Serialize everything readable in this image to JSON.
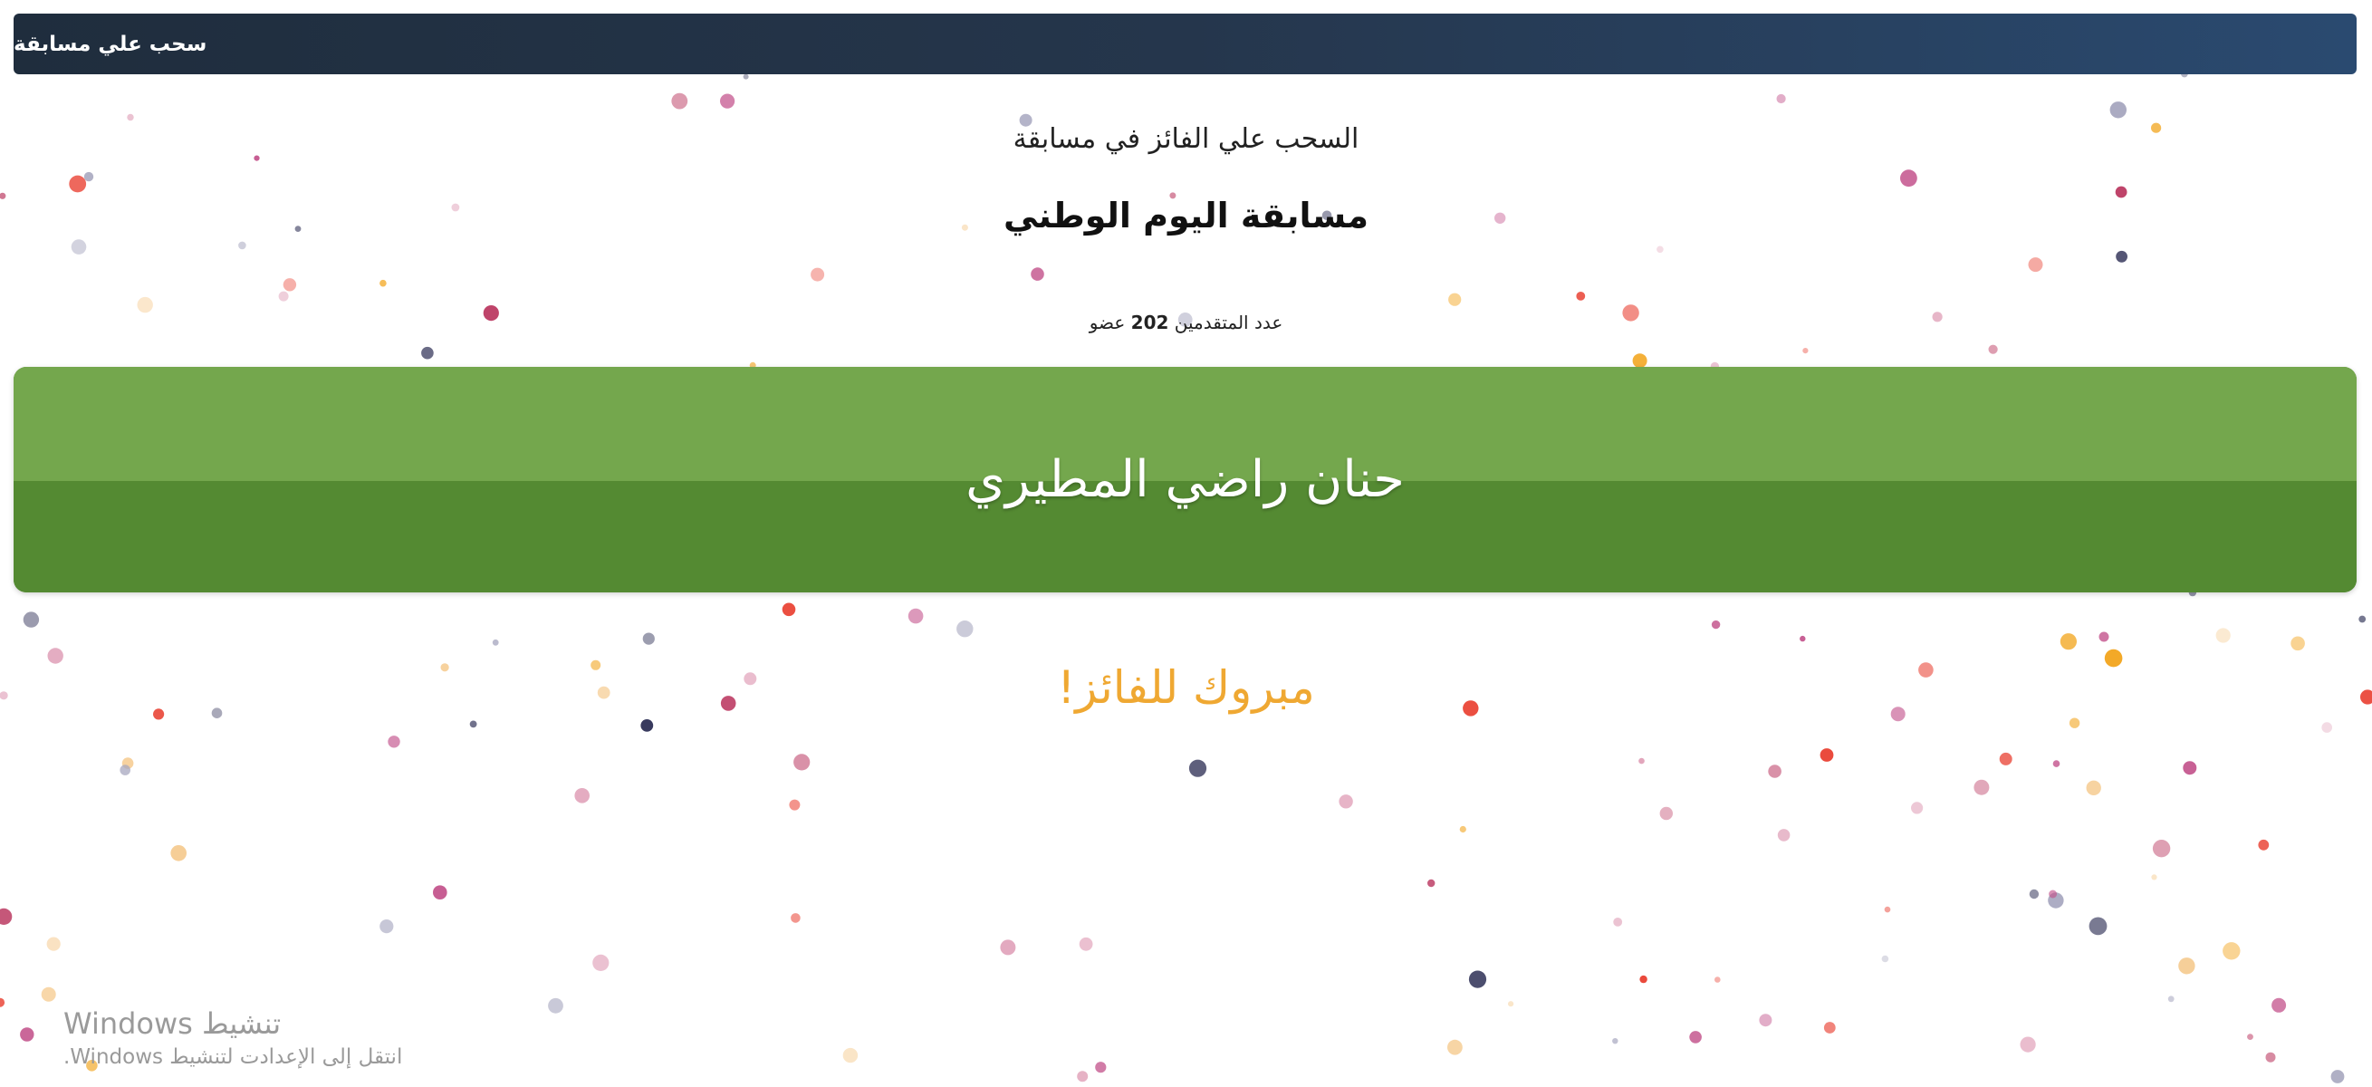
{
  "window": {
    "title": "سحب علي مسابقة"
  },
  "header": {
    "subtitle": "السحب علي الفائز في مسابقة",
    "competition_name": "مسابقة اليوم الوطني"
  },
  "applicants": {
    "label": "عدد المتقدمين",
    "count": "202",
    "unit": "عضو"
  },
  "winner": {
    "name": "حنان راضي المطيري",
    "colors": {
      "top": "#74a74d",
      "bottom": "#548a32"
    }
  },
  "congrats": {
    "text": "مبروك للفائز!",
    "color": "#efa832"
  },
  "windows_activation": {
    "title": "تنشيط Windows",
    "subtitle": "انتقل إلى الإعدادت لتنشيط Windows."
  },
  "confetti": {
    "palette": [
      "#b8305a",
      "#e8392a",
      "#f2a41c",
      "#2d2f55",
      "#c2508a",
      "#e0a0b8",
      "#a7a7bf",
      "#f5c98c"
    ]
  }
}
